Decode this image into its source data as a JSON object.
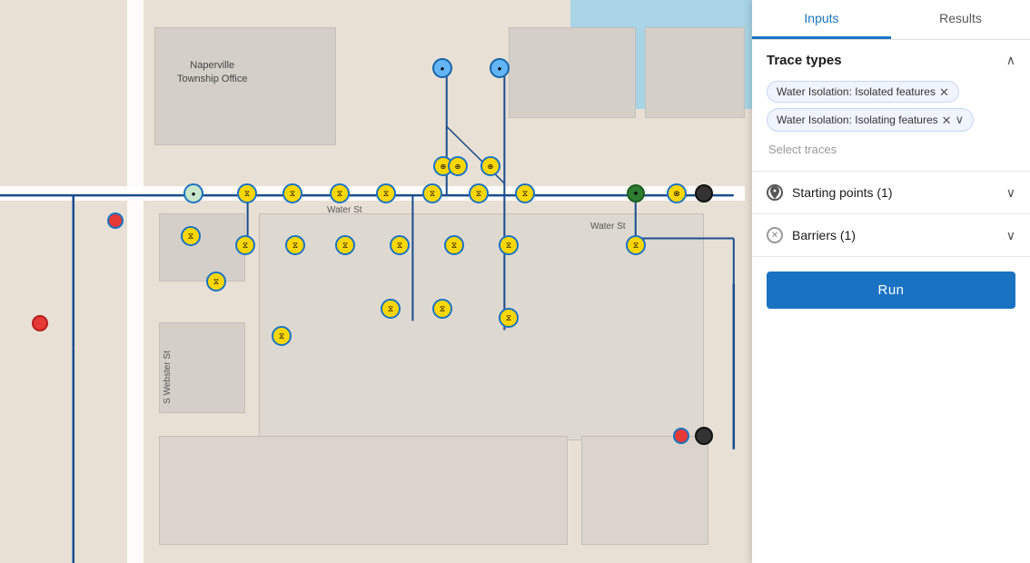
{
  "tabs": [
    {
      "label": "Inputs",
      "active": true
    },
    {
      "label": "Results",
      "active": false
    }
  ],
  "traceTypes": {
    "sectionTitle": "Trace types",
    "tags": [
      {
        "label": "Water Isolation: Isolated features",
        "hasExpand": false
      },
      {
        "label": "Water Isolation: Isolating features",
        "hasExpand": true
      }
    ],
    "placeholder": "Select traces"
  },
  "startingPoints": {
    "sectionTitle": "Starting points (1)",
    "icon": "location-dot"
  },
  "barriers": {
    "sectionTitle": "Barriers (1)",
    "icon": "x-circle"
  },
  "runButton": {
    "label": "Run"
  },
  "map": {
    "placeLabel1": "Naperville",
    "placeLabel2": "Township Office",
    "streetLabelV": "S Webster St",
    "streetLabelH1": "Water St",
    "streetLabelH2": "Water St"
  },
  "colors": {
    "networkLine": "#1a4d8f",
    "panelBg": "#ffffff",
    "activeTab": "#1a73c2",
    "runBtn": "#1a73c2",
    "tagBg": "#f0f4ff",
    "tagBorder": "#c5d5f5"
  }
}
